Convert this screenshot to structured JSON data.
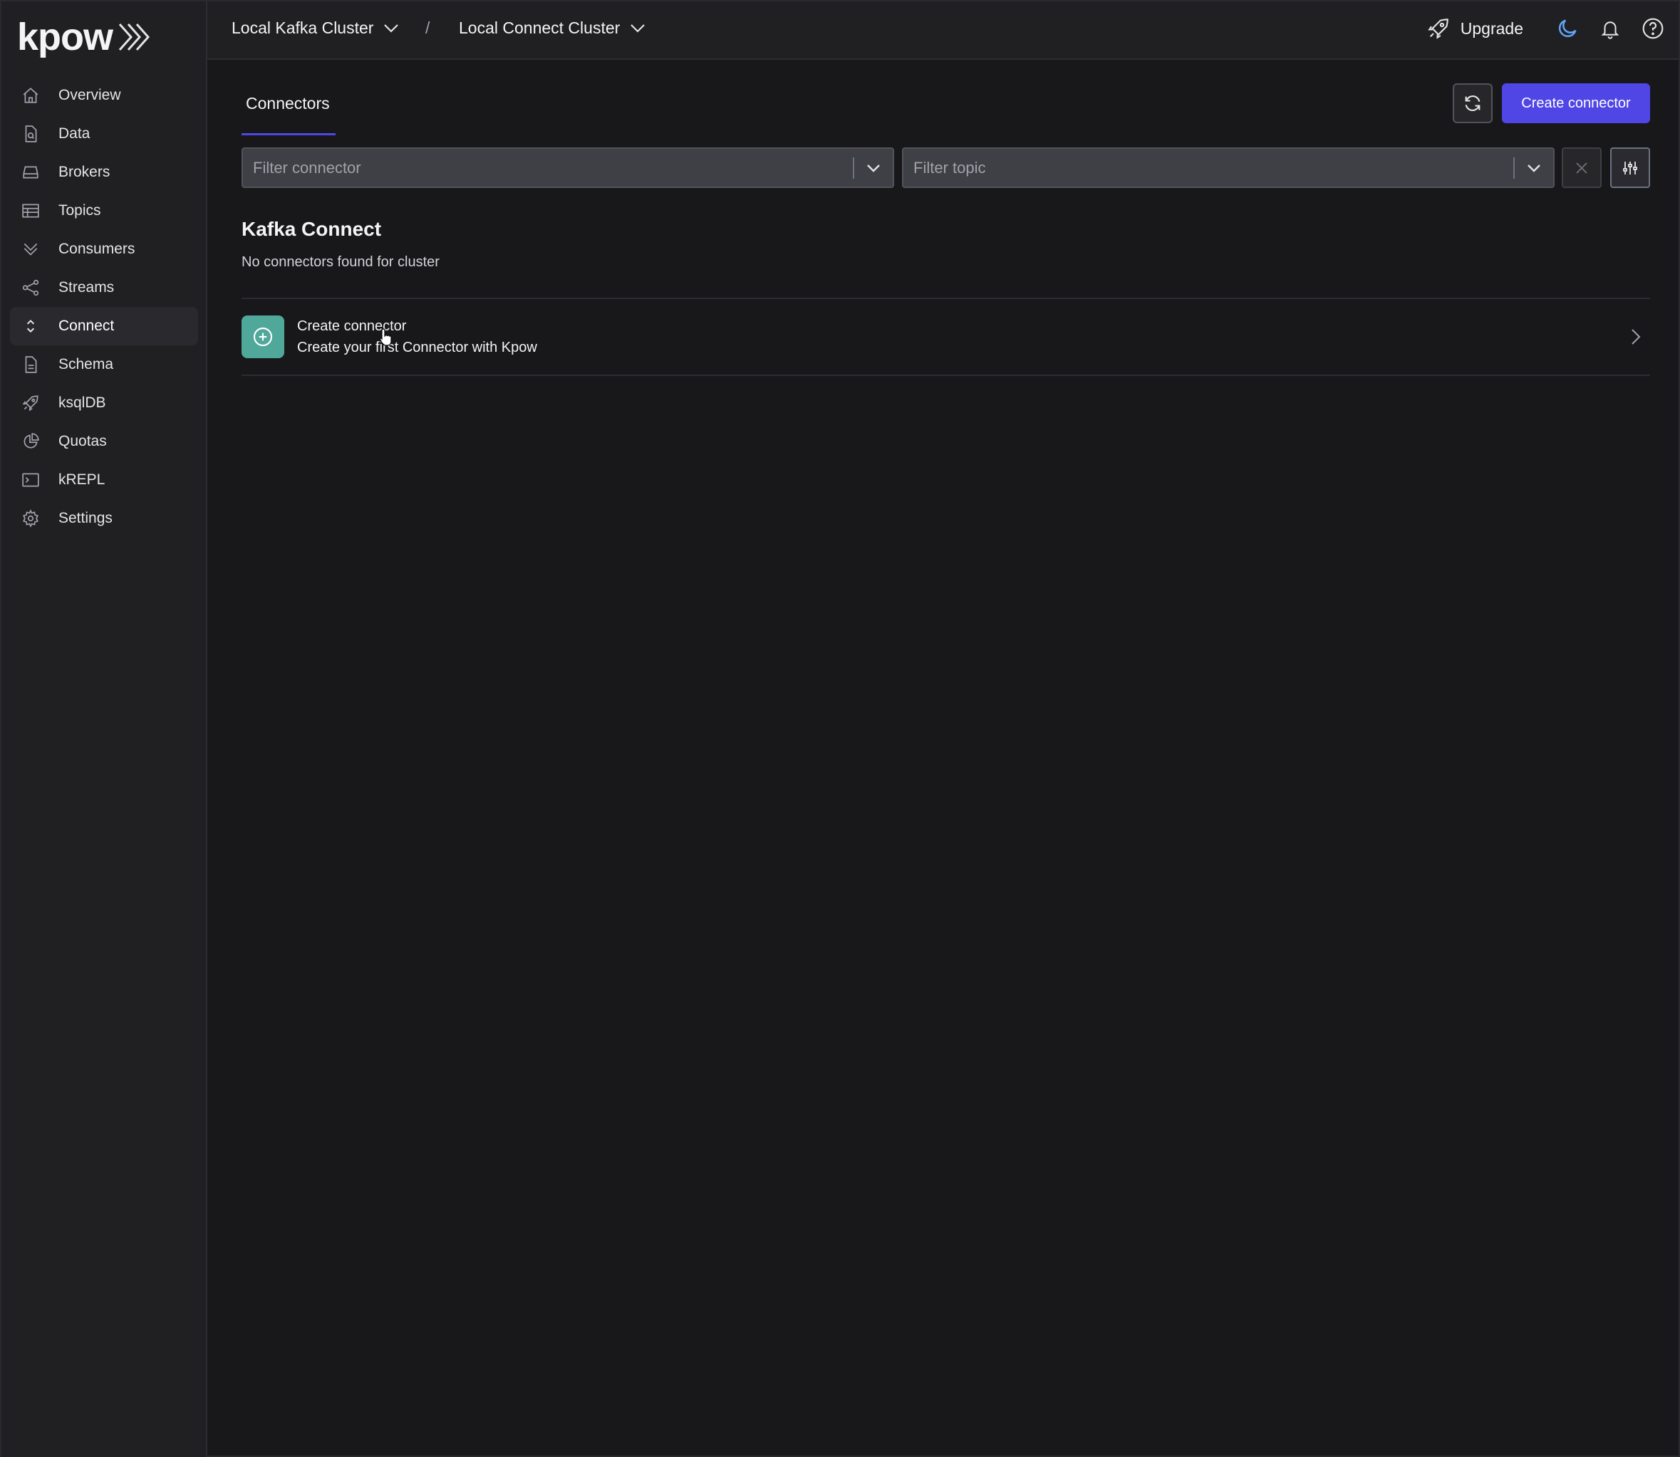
{
  "brand": {
    "name": "kpow"
  },
  "sidebar": {
    "items": [
      {
        "label": "Overview",
        "icon": "home-icon"
      },
      {
        "label": "Data",
        "icon": "document-search-icon"
      },
      {
        "label": "Brokers",
        "icon": "server-icon"
      },
      {
        "label": "Topics",
        "icon": "table-icon"
      },
      {
        "label": "Consumers",
        "icon": "chevrons-down-icon"
      },
      {
        "label": "Streams",
        "icon": "share-icon"
      },
      {
        "label": "Connect",
        "icon": "selector-icon",
        "active": true
      },
      {
        "label": "Schema",
        "icon": "document-text-icon"
      },
      {
        "label": "ksqlDB",
        "icon": "rocket-icon"
      },
      {
        "label": "Quotas",
        "icon": "pie-chart-icon"
      },
      {
        "label": "kREPL",
        "icon": "terminal-icon"
      },
      {
        "label": "Settings",
        "icon": "gear-icon"
      }
    ]
  },
  "header": {
    "cluster": "Local Kafka Cluster",
    "separator": "/",
    "connect_cluster": "Local Connect Cluster",
    "upgrade_label": "Upgrade"
  },
  "main": {
    "tab_label": "Connectors",
    "create_button": "Create connector",
    "filter_connector_placeholder": "Filter connector",
    "filter_topic_placeholder": "Filter topic",
    "section_title": "Kafka Connect",
    "empty_message": "No connectors found for cluster",
    "card": {
      "title": "Create connector",
      "subtitle": "Create your first Connector with Kpow"
    }
  },
  "colors": {
    "accent": "#4f46e5",
    "card_badge": "#4fa89a",
    "moon": "#60a5fa",
    "background": "#18181b",
    "sidebar": "#202023"
  }
}
